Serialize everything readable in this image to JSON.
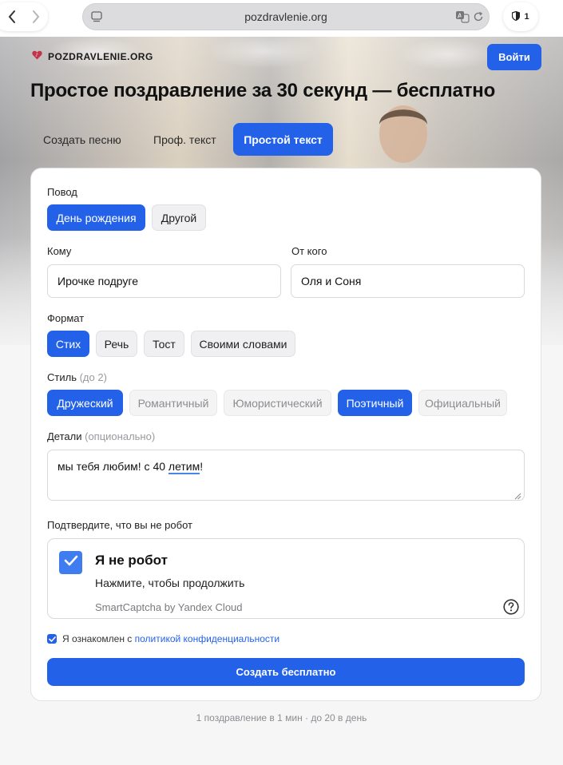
{
  "browser": {
    "url": "pozdravlenie.org",
    "shield_count": "1"
  },
  "header": {
    "logo_text": "POZDRAVLENIE.ORG",
    "login_label": "Войти",
    "title": "Простое поздравление за 30 секунд — бесплатно",
    "tabs": [
      {
        "label": "Создать песню",
        "active": false
      },
      {
        "label": "Проф. текст",
        "active": false
      },
      {
        "label": "Простой текст",
        "active": true
      }
    ]
  },
  "form": {
    "occasion": {
      "label": "Повод",
      "options": [
        {
          "label": "День рождения",
          "selected": true
        },
        {
          "label": "Другой",
          "selected": false
        }
      ]
    },
    "to": {
      "label": "Кому",
      "value": "Ирочке подруге"
    },
    "from": {
      "label": "От кого",
      "value": "Оля и Соня"
    },
    "format": {
      "label": "Формат",
      "options": [
        {
          "label": "Стих",
          "selected": true
        },
        {
          "label": "Речь",
          "selected": false
        },
        {
          "label": "Тост",
          "selected": false
        },
        {
          "label": "Своими словами",
          "selected": false
        }
      ]
    },
    "style": {
      "label": "Стиль",
      "hint": "(до 2)",
      "options": [
        {
          "label": "Дружеский",
          "selected": true
        },
        {
          "label": "Романтичный",
          "selected": false
        },
        {
          "label": "Юмористический",
          "selected": false
        },
        {
          "label": "Поэтичный",
          "selected": true
        },
        {
          "label": "Официальный",
          "selected": false
        }
      ]
    },
    "details": {
      "label": "Детали",
      "hint": "(опционально)",
      "value_before": "мы тебя любим! с 40 ",
      "value_underlined": "летим",
      "value_after": "!"
    },
    "captcha": {
      "label": "Подтвердите, что вы не робот",
      "title": "Я не робот",
      "subtitle": "Нажмите, чтобы продолжить",
      "brand": "SmartCaptcha by Yandex Cloud",
      "checked": true
    },
    "consent": {
      "text": "Я ознакомлен с ",
      "link": "политикой конфиденциальности",
      "checked": true
    },
    "submit_label": "Создать бесплатно"
  },
  "footer": {
    "note": "1 поздравление в 1 мин · до 20 в день"
  },
  "colors": {
    "accent": "#2362e8",
    "captcha_check": "#3f7cf0"
  }
}
